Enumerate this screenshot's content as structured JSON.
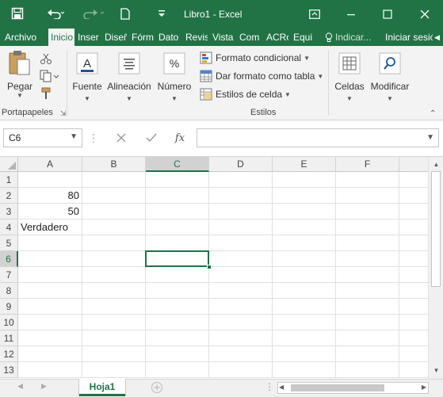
{
  "window": {
    "title": "Libro1 - Excel"
  },
  "ribbon_tabs": {
    "archivo": "Archivo",
    "inicio": "Inicio",
    "insertar": "Inser",
    "disenio": "Diseñ",
    "formulas": "Fórm",
    "datos": "Dato",
    "revisar": "Revis",
    "vista": "Vista",
    "complementos": "Com",
    "acrobat": "ACRó",
    "equipo": "Equi",
    "tell_me": "Indicar...",
    "signin": "Iniciar sesió"
  },
  "ribbon": {
    "pegar": "Pegar",
    "portapapeles": "Portapapeles",
    "fuente": "Fuente",
    "alineacion": "Alineación",
    "numero": "Número",
    "formato_condicional": "Formato condicional",
    "dar_formato_tabla": "Dar formato como tabla",
    "estilos_celda": "Estilos de celda",
    "estilos": "Estilos",
    "celdas": "Celdas",
    "modificar": "Modificar",
    "percent_glyph": "%"
  },
  "formula_bar": {
    "name_box": "C6",
    "fx": "fx",
    "value": ""
  },
  "grid": {
    "columns": [
      "A",
      "B",
      "C",
      "D",
      "E",
      "F"
    ],
    "selected_column": "C",
    "rows": [
      "1",
      "2",
      "3",
      "4",
      "5",
      "6",
      "7",
      "8",
      "9",
      "10",
      "11",
      "12",
      "13"
    ],
    "selected_row": "6",
    "cells": {
      "A2": "80",
      "A3": "50",
      "A4": "Verdadero"
    },
    "active_cell": "C6"
  },
  "sheets": {
    "active": "Hoja1"
  },
  "colors": {
    "accent": "#217346"
  },
  "icons": [
    "save-icon",
    "undo-icon",
    "redo-icon",
    "new-doc-icon",
    "customize-icon",
    "ribbon-display-icon",
    "minimize-icon",
    "maximize-icon",
    "close-icon",
    "lightbulb-icon",
    "paste-icon",
    "cut-icon",
    "copy-icon",
    "format-painter-icon",
    "font-icon",
    "alignment-icon",
    "number-format-icon",
    "conditional-format-icon",
    "table-format-icon",
    "cell-styles-icon",
    "cells-icon",
    "search-edit-icon",
    "add-sheet-icon"
  ]
}
